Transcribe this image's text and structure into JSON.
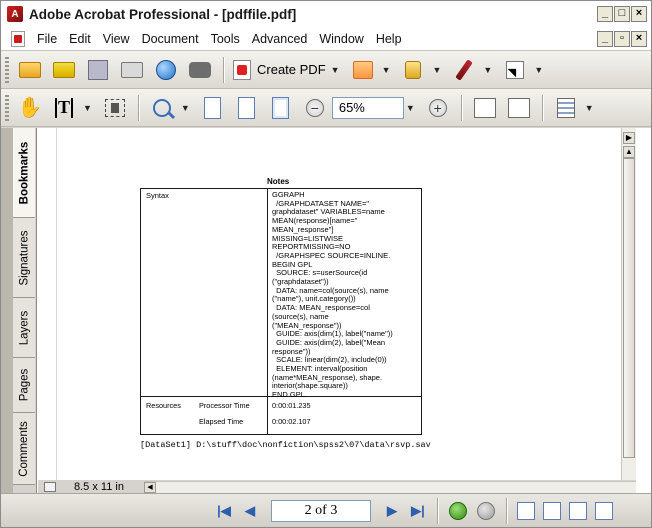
{
  "window": {
    "title": "Adobe Acrobat Professional - [pdffile.pdf]",
    "app_icon": "acrobat-icon",
    "controls": {
      "minimize": "_",
      "restore": "□",
      "close": "×"
    }
  },
  "menu": {
    "items": [
      "File",
      "Edit",
      "View",
      "Document",
      "Tools",
      "Advanced",
      "Window",
      "Help"
    ],
    "doc_controls": {
      "minimize": "_",
      "restore": "▫",
      "close": "×"
    }
  },
  "toolbar1": {
    "create_pdf_label": "Create PDF",
    "icons": [
      "open-icon",
      "organizer-icon",
      "save-icon",
      "print-icon",
      "email-icon",
      "search-icon",
      "create-pdf-icon",
      "combine-icon",
      "secure-icon",
      "sign-icon",
      "select-object-icon"
    ]
  },
  "toolbar2": {
    "zoom_value": "65%",
    "icons": [
      "hand-icon",
      "select-text-icon",
      "snapshot-icon",
      "zoom-icon",
      "actual-size-icon",
      "fit-page-icon",
      "fit-width-icon",
      "zoom-out-icon",
      "zoom-in-icon",
      "rotate-cw-icon",
      "rotate-ccw-icon",
      "page-layout-icon"
    ]
  },
  "side_tabs": [
    "Bookmarks",
    "Signatures",
    "Layers",
    "Pages",
    "Comments"
  ],
  "document": {
    "notes_title": "Notes",
    "syntax_label": "Syntax",
    "syntax_lines": [
      "GGRAPH",
      "  /GRAPHDATASET NAME=\"",
      "graphdataset\" VARIABLES=name",
      "MEAN(response)[name=\"",
      "MEAN_response\"]",
      "MISSING=LISTWISE",
      "REPORTMISSING=NO",
      "  /GRAPHSPEC SOURCE=INLINE.",
      "BEGIN GPL",
      "  SOURCE: s=userSource(id",
      "(\"graphdataset\"))",
      "  DATA: name=col(source(s), name",
      "(\"name\"), unit.category())",
      "  DATA: MEAN_response=col",
      "(source(s), name",
      "(\"MEAN_response\"))",
      "  GUIDE: axis(dim(1), label(\"name\"))",
      "  GUIDE: axis(dim(2), label(\"Mean",
      "response\"))",
      "  SCALE: linear(dim(2), include(0))",
      "  ELEMENT: interval(position",
      "(name*MEAN_response), shape.",
      "interior(shape.square))",
      "END GPL."
    ],
    "resources_label": "Resources",
    "processor_label": "Processor Time",
    "processor_value": "0:00:01.235",
    "elapsed_label": "Elapsed Time",
    "elapsed_value": "0:00:02.107",
    "dataset_line": "[DataSet1] D:\\stuff\\doc\\nonfiction\\spss2\\07\\data\\rsvp.sav"
  },
  "page_size": "8.5 x 11 in",
  "navigation": {
    "page_counter": "2 of 3",
    "icons": [
      "first-page-icon",
      "previous-page-icon",
      "next-page-icon",
      "last-page-icon",
      "go-back-icon",
      "go-forward-icon",
      "single-page-icon",
      "continuous-icon",
      "facing-icon",
      "continuous-facing-icon"
    ]
  }
}
